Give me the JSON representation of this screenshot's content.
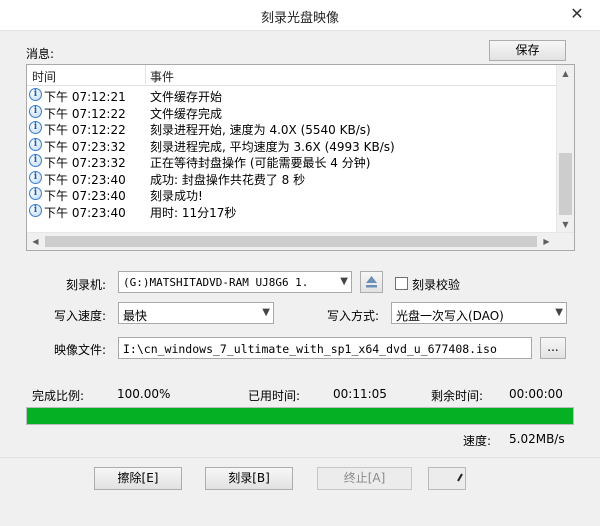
{
  "window": {
    "title": "刻录光盘映像",
    "close_glyph": "✕"
  },
  "messages_label": "消息:",
  "save_button": "保存",
  "log": {
    "columns": [
      "时间",
      "事件"
    ],
    "rows": [
      {
        "time": "下午 07:12:21",
        "event": "文件缓存开始"
      },
      {
        "time": "下午 07:12:22",
        "event": "文件缓存完成"
      },
      {
        "time": "下午 07:12:22",
        "event": "刻录进程开始, 速度为 4.0X (5540 KB/s)"
      },
      {
        "time": "下午 07:23:32",
        "event": "刻录进程完成, 平均速度为 3.6X (4993 KB/s)"
      },
      {
        "time": "下午 07:23:32",
        "event": "正在等待封盘操作 (可能需要最长 4 分钟)"
      },
      {
        "time": "下午 07:23:40",
        "event": "成功: 封盘操作共花费了 8 秒"
      },
      {
        "time": "下午 07:23:40",
        "event": "刻录成功!"
      },
      {
        "time": "下午 07:23:40",
        "event": "用时: 11分17秒"
      }
    ],
    "info_icon": "info-icon"
  },
  "burner": {
    "label": "刻录机:",
    "value": "(G:)MATSHITADVD-RAM UJ8G6   1."
  },
  "verify": {
    "label": "刻录校验",
    "checked": false
  },
  "speed": {
    "label": "写入速度:",
    "value": "最快"
  },
  "write_mode": {
    "label": "写入方式:",
    "value": "光盘一次写入(DAO)"
  },
  "image_file": {
    "label": "映像文件:",
    "value": "I:\\cn_windows_7_ultimate_with_sp1_x64_dvd_u_677408.iso",
    "browse_label": "..."
  },
  "status": {
    "ratio_label": "完成比例:",
    "ratio_value": "100.00%",
    "elapsed_label": "已用时间:",
    "elapsed_value": "00:11:05",
    "remaining_label": "剩余时间:",
    "remaining_value": "00:00:00",
    "progress": 1.0,
    "speed_label": "速度:",
    "speed_value": "5.02MB/s"
  },
  "buttons": {
    "erase": "擦除[E]",
    "burn": "刻录[B]",
    "stop": "终止[A]"
  },
  "colors": {
    "progress_fill": "#06b025",
    "info_icon": "#3a7ec9"
  }
}
